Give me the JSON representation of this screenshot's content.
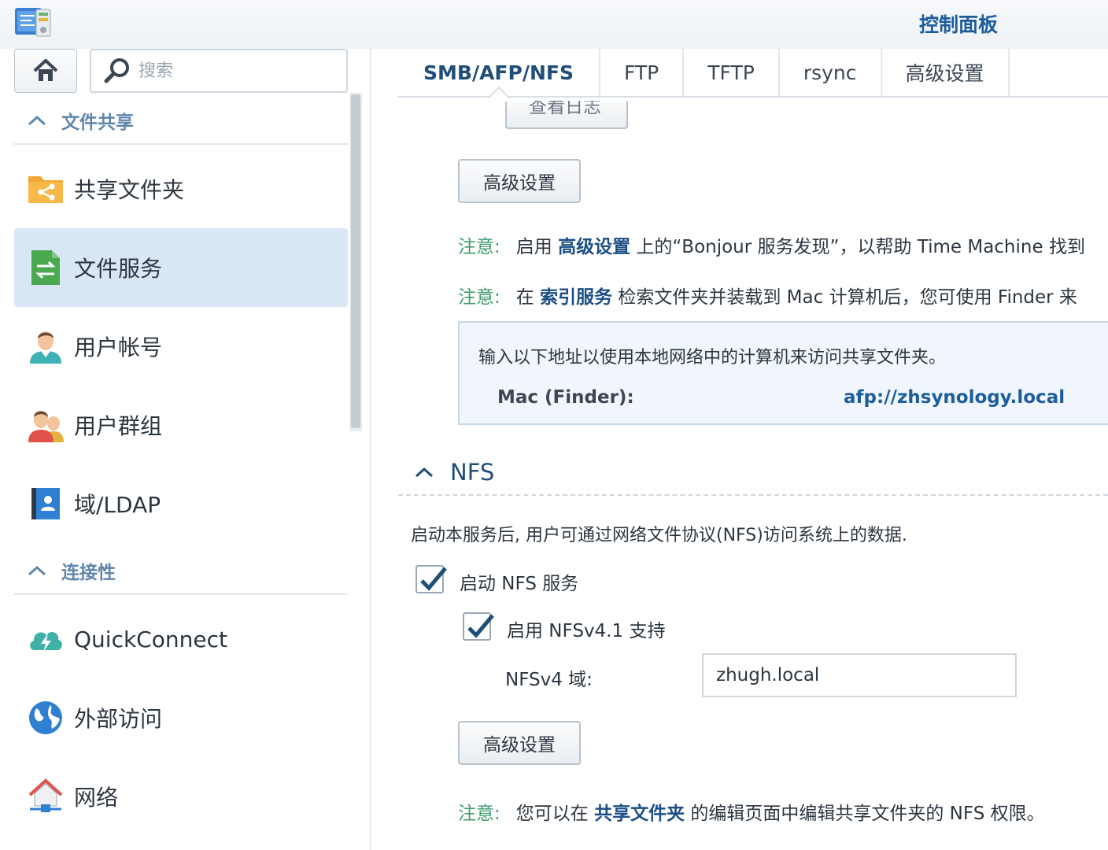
{
  "window": {
    "title": "控制面板",
    "app_icon": "control-panel-icon"
  },
  "sidebar": {
    "home_icon": "home-icon",
    "search": {
      "placeholder": "搜索",
      "value": ""
    },
    "sections": [
      {
        "label": "文件共享",
        "items": [
          {
            "label": "共享文件夹",
            "icon": "shared-folder-icon",
            "active": false
          },
          {
            "label": "文件服务",
            "icon": "file-services-icon",
            "active": true
          },
          {
            "label": "用户帐号",
            "icon": "user-icon",
            "active": false
          },
          {
            "label": "用户群组",
            "icon": "group-icon",
            "active": false
          },
          {
            "label": "域/LDAP",
            "icon": "domain-ldap-icon",
            "active": false
          }
        ]
      },
      {
        "label": "连接性",
        "items": [
          {
            "label": "QuickConnect",
            "icon": "quickconnect-icon",
            "active": false
          },
          {
            "label": "外部访问",
            "icon": "globe-icon",
            "active": false
          },
          {
            "label": "网络",
            "icon": "network-icon",
            "active": false
          }
        ]
      }
    ]
  },
  "tabs": [
    {
      "label": "SMB/AFP/NFS",
      "active": true
    },
    {
      "label": "FTP",
      "active": false
    },
    {
      "label": "TFTP",
      "active": false
    },
    {
      "label": "rsync",
      "active": false
    },
    {
      "label": "高级设置",
      "active": false
    }
  ],
  "afp": {
    "partial_button": "查看日志",
    "advanced_button": "高级设置",
    "note1": {
      "tag": "注意:",
      "pre": "启用",
      "link": "高级设置",
      "post": "上的“Bonjour 服务发现”，以帮助 Time Machine 找到"
    },
    "note2": {
      "tag": "注意:",
      "pre": "在",
      "link": "索引服务",
      "post": "检索文件夹并装载到 Mac 计算机后，您可使用 Finder 来"
    },
    "info_desc": "输入以下地址以使用本地网络中的计算机来访问共享文件夹。",
    "mac_label": "Mac (Finder):",
    "mac_value": "afp://zhsynology.local"
  },
  "nfs": {
    "header": "NFS",
    "description": "启动本服务后, 用户可通过网络文件协议(NFS)访问系统上的数据.",
    "enable_label": "启动 NFS 服务",
    "enable_checked": true,
    "v41_label": "启用 NFSv4.1 支持",
    "v41_checked": true,
    "domain_label": "NFSv4 域:",
    "domain_value": "zhugh.local",
    "advanced_button": "高级设置",
    "note": {
      "tag": "注意:",
      "pre": "您可以在",
      "link": "共享文件夹",
      "post": "的编辑页面中编辑共享文件夹的 NFS 权限。"
    }
  },
  "colors": {
    "accent": "#1d5d9b",
    "active_bg": "#d9e6f6",
    "note_green": "#3f9a6e",
    "section_label": "#5f86ad"
  }
}
